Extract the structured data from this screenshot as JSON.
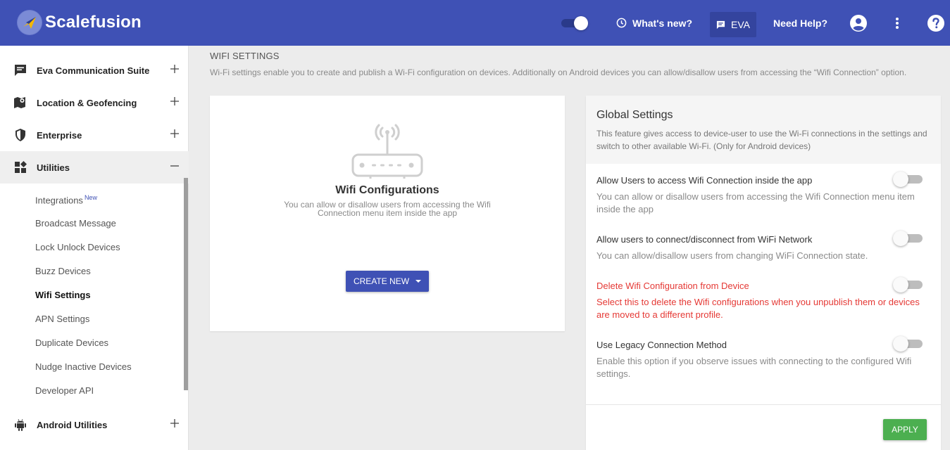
{
  "header": {
    "logo_text": "Scalefusion",
    "whats_new": "What's new?",
    "eva": "EVA",
    "need_help": "Need Help?",
    "icons": [
      "clock-icon",
      "chat-icon",
      "account-icon",
      "more-vertical-icon",
      "help-icon"
    ],
    "toggle_on": true
  },
  "sidebar": {
    "groups": [
      {
        "label": "Eva Communication Suite",
        "icon": "chat-icon",
        "expanded": false
      },
      {
        "label": "Location & Geofencing",
        "icon": "map-marker-icon",
        "expanded": false
      },
      {
        "label": "Enterprise",
        "icon": "shield-icon",
        "expanded": false
      },
      {
        "label": "Utilities",
        "icon": "widgets-icon",
        "expanded": true
      },
      {
        "label": "Android Utilities",
        "icon": "android-icon",
        "expanded": false
      }
    ],
    "sub_items": [
      {
        "label": "Integrations",
        "badge": "New"
      },
      {
        "label": "Broadcast Message"
      },
      {
        "label": "Lock Unlock Devices"
      },
      {
        "label": "Buzz Devices"
      },
      {
        "label": "Wifi Settings",
        "active": true
      },
      {
        "label": "APN Settings"
      },
      {
        "label": "Duplicate Devices"
      },
      {
        "label": "Nudge Inactive Devices"
      },
      {
        "label": "Developer API"
      }
    ]
  },
  "main": {
    "title": "WIFI SETTINGS",
    "description": "Wi-Fi settings enable you to create and publish a Wi-Fi configuration on devices. Additionally on Android devices you can allow/disallow users from accessing the “Wifi Connection” option.",
    "wifi_card": {
      "title": "Wifi Configurations",
      "description": "You can allow or disallow users from accessing the Wifi Connection menu item inside the app",
      "create_button": "CREATE NEW"
    },
    "global_settings": {
      "title": "Global Settings",
      "description": "This feature gives access to device-user to use the Wi-Fi connections in the settings and switch to other available Wi-Fi. (Only for Android devices)",
      "options": [
        {
          "title": "Allow Users to access Wifi Connection inside the app",
          "description": "You can allow or disallow users from accessing the Wifi Connection menu item inside the app",
          "enabled": false
        },
        {
          "title": "Allow users to connect/disconnect from WiFi Network",
          "description": "You can allow/disallow users from changing WiFi Connection state.",
          "enabled": false
        },
        {
          "title": "Delete Wifi Configuration from Device",
          "description": "Select this to delete the Wifi configurations when you unpublish them or devices are moved to a different profile.",
          "enabled": false,
          "color": "#e53935"
        },
        {
          "title": "Use Legacy Connection Method",
          "description": "Enable this option if you observe issues with connecting to the configured Wifi settings.",
          "enabled": false
        }
      ],
      "apply_button": "APPLY"
    }
  },
  "colors": {
    "header": "#3f51b5",
    "apply": "#4caf50",
    "danger": "#e53935"
  }
}
